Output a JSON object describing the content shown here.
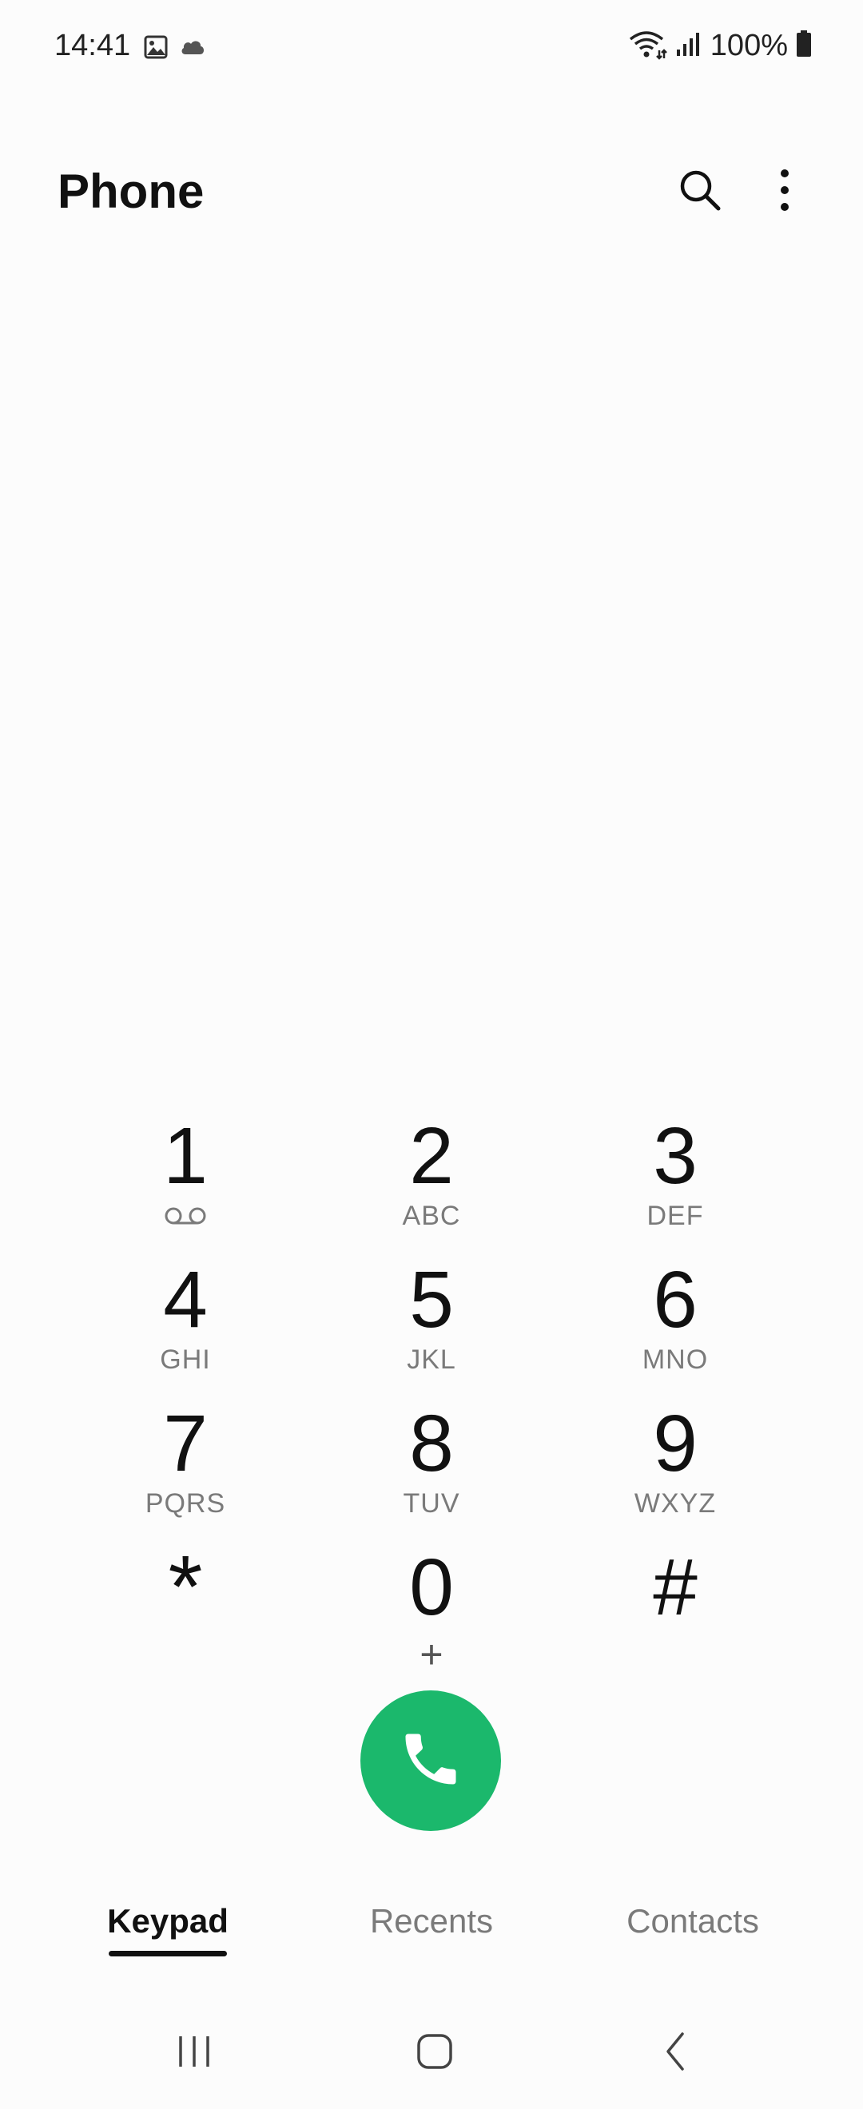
{
  "status_bar": {
    "time": "14:41",
    "notification_icons": [
      "gallery-icon",
      "cloud-icon"
    ],
    "wifi_icon": "wifi-icon",
    "signal_icon": "signal-icon",
    "battery_percent": "100%",
    "battery_icon": "battery-icon"
  },
  "app_bar": {
    "title": "Phone",
    "search_icon": "search-icon",
    "more_icon": "more-options-icon"
  },
  "dialpad": {
    "keys": [
      {
        "digit": "1",
        "letters": "",
        "sub_icon": "voicemail-icon"
      },
      {
        "digit": "2",
        "letters": "ABC"
      },
      {
        "digit": "3",
        "letters": "DEF"
      },
      {
        "digit": "4",
        "letters": "GHI"
      },
      {
        "digit": "5",
        "letters": "JKL"
      },
      {
        "digit": "6",
        "letters": "MNO"
      },
      {
        "digit": "7",
        "letters": "PQRS"
      },
      {
        "digit": "8",
        "letters": "TUV"
      },
      {
        "digit": "9",
        "letters": "WXYZ"
      },
      {
        "digit": "*",
        "letters": ""
      },
      {
        "digit": "0",
        "letters": "+"
      },
      {
        "digit": "#",
        "letters": ""
      }
    ]
  },
  "call_button": {
    "icon": "phone-icon",
    "color": "#1bb86c"
  },
  "tabs": [
    {
      "label": "Keypad",
      "active": true
    },
    {
      "label": "Recents",
      "active": false
    },
    {
      "label": "Contacts",
      "active": false
    }
  ],
  "nav_bar": {
    "recents_icon": "recent-apps-icon",
    "home_icon": "home-icon",
    "back_icon": "back-icon"
  }
}
